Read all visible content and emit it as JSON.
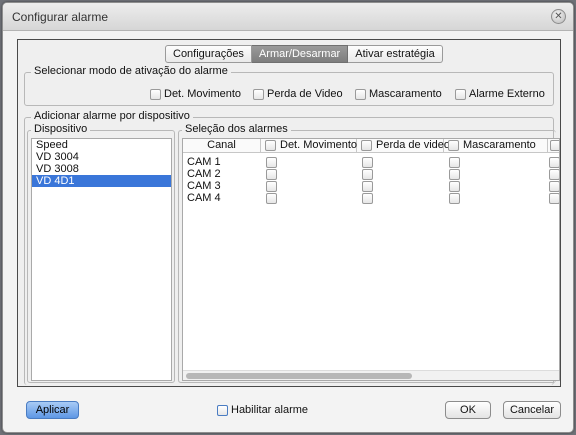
{
  "window": {
    "title": "Configurar alarme"
  },
  "tabs": [
    {
      "label": "Configurações",
      "active": false
    },
    {
      "label": "Armar/Desarmar",
      "active": true
    },
    {
      "label": "Ativar estratégia",
      "active": false
    }
  ],
  "activation_mode": {
    "legend": "Selecionar modo de ativação do alarme",
    "options": [
      "Det. Movimento",
      "Perda de Video",
      "Mascaramento",
      "Alarme Externo"
    ]
  },
  "per_device": {
    "legend": "Adicionar alarme por dispositivo",
    "device_legend": "Dispositivo",
    "devices": [
      "Speed",
      "VD 3004",
      "VD 3008",
      "VD 4D1"
    ],
    "selected_device": "VD 4D1",
    "selection_legend": "Seleção dos alarmes",
    "columns": [
      "Canal",
      "Det. Movimento",
      "Perda de video",
      "Mascaramento",
      "A"
    ],
    "rows": [
      "CAM 1",
      "CAM 2",
      "CAM 3",
      "CAM 4"
    ]
  },
  "footer": {
    "apply": "Aplicar",
    "enable_alarm": "Habilitar alarme",
    "ok": "OK",
    "cancel": "Cancelar"
  },
  "colors": {
    "selection": "#3a76d9",
    "primary_button": "#5e97e4",
    "active_tab": "#8a8a8a"
  }
}
